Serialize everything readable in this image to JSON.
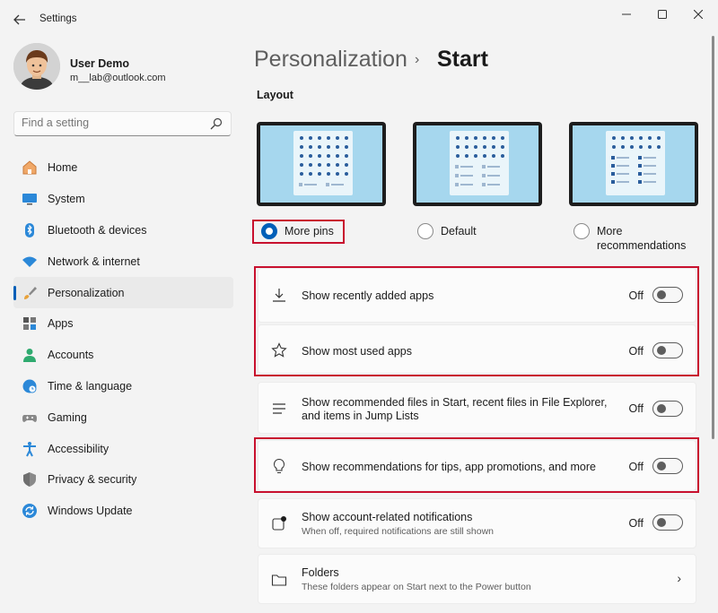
{
  "titlebar": {
    "app_title": "Settings",
    "back_icon": "back-arrow-icon"
  },
  "profile": {
    "name": "User Demo",
    "email": "m__lab@outlook.com"
  },
  "search": {
    "placeholder": "Find a setting"
  },
  "sidebar": {
    "items": [
      {
        "label": "Home",
        "icon": "home-icon"
      },
      {
        "label": "System",
        "icon": "monitor-icon"
      },
      {
        "label": "Bluetooth & devices",
        "icon": "bluetooth-icon"
      },
      {
        "label": "Network & internet",
        "icon": "wifi-icon"
      },
      {
        "label": "Personalization",
        "icon": "brush-icon",
        "selected": true
      },
      {
        "label": "Apps",
        "icon": "apps-icon"
      },
      {
        "label": "Accounts",
        "icon": "person-icon"
      },
      {
        "label": "Time & language",
        "icon": "globe-icon"
      },
      {
        "label": "Gaming",
        "icon": "controller-icon"
      },
      {
        "label": "Accessibility",
        "icon": "accessibility-icon"
      },
      {
        "label": "Privacy & security",
        "icon": "shield-icon"
      },
      {
        "label": "Windows Update",
        "icon": "update-icon"
      }
    ]
  },
  "header": {
    "parent": "Personalization",
    "current": "Start"
  },
  "layout": {
    "title": "Layout",
    "options": [
      {
        "label": "More pins",
        "checked": true
      },
      {
        "label": "Default",
        "checked": false
      },
      {
        "label_line1": "More",
        "label_line2": "recommendations",
        "checked": false
      }
    ]
  },
  "settings": [
    {
      "title": "Show recently added apps",
      "state": "Off",
      "icon": "download-icon"
    },
    {
      "title": "Show most used apps",
      "state": "Off",
      "icon": "star-icon"
    },
    {
      "title_line1": "Show recommended files in Start, recent files in File Explorer,",
      "title_line2": "and items in Jump Lists",
      "state": "Off",
      "icon": "list-icon"
    },
    {
      "title": "Show recommendations for tips, app promotions, and more",
      "state": "Off",
      "icon": "lightbulb-icon"
    },
    {
      "title": "Show account-related notifications",
      "desc": "When off, required notifications are still shown",
      "state": "Off",
      "icon": "notification-icon"
    },
    {
      "title": "Folders",
      "desc": "These folders appear on Start next to the Power button",
      "icon": "folder-icon"
    }
  ],
  "colors": {
    "accent": "#005fb8",
    "highlight": "#c8102e"
  }
}
